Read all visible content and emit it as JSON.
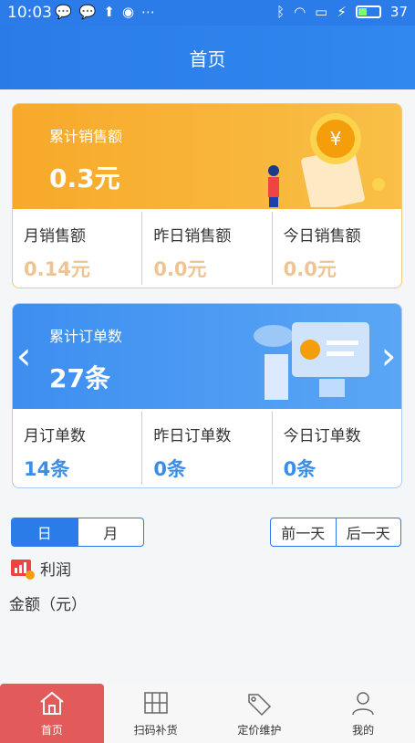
{
  "status_bar": {
    "time": "10:03",
    "battery": "37"
  },
  "header": {
    "title": "首页"
  },
  "sales_card": {
    "label": "累计销售额",
    "value": "0.3元",
    "stats": [
      {
        "label": "月销售额",
        "value": "0.14元"
      },
      {
        "label": "昨日销售额",
        "value": "0.0元"
      },
      {
        "label": "今日销售额",
        "value": "0.0元"
      }
    ]
  },
  "orders_card": {
    "label": "累计订单数",
    "value": "27条",
    "stats": [
      {
        "label": "月订单数",
        "value": "14条"
      },
      {
        "label": "昨日订单数",
        "value": "0条"
      },
      {
        "label": "今日订单数",
        "value": "0条"
      }
    ]
  },
  "period_toggle": {
    "day": "日",
    "month": "月",
    "selected": "日"
  },
  "day_nav": {
    "prev": "前一天",
    "next": "后一天"
  },
  "profit": {
    "label": "利润",
    "amount_label": "金额（元）"
  },
  "tabbar": [
    {
      "label": "首页",
      "icon": "home-icon"
    },
    {
      "label": "扫码补货",
      "icon": "scan-grid-icon"
    },
    {
      "label": "定价维护",
      "icon": "price-tag-icon"
    },
    {
      "label": "我的",
      "icon": "user-icon"
    }
  ],
  "colors": {
    "primary": "#2b7be8",
    "sales_orange": "#f7a92a",
    "active_tab": "#e35a5a"
  }
}
